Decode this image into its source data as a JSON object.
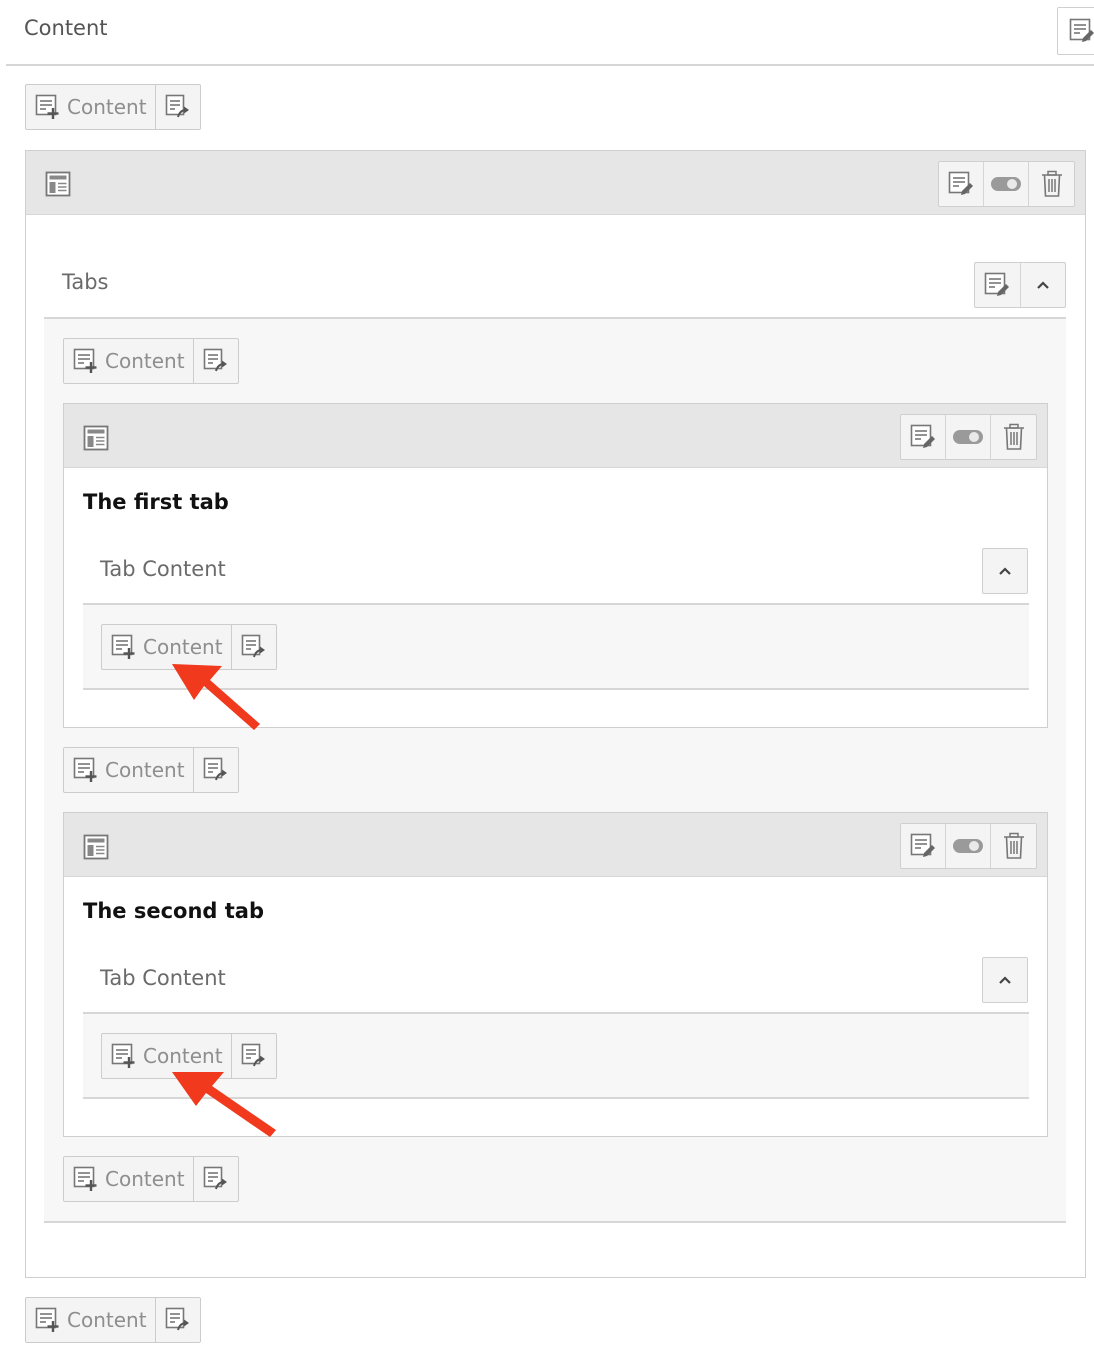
{
  "page": {
    "section_title": "Content",
    "new_content_label": "Content"
  },
  "tabs_container": {
    "title": "Tabs"
  },
  "tabs": [
    {
      "title": "The first tab",
      "column_label": "Tab Content"
    },
    {
      "title": "The second tab",
      "column_label": "Tab Content"
    }
  ],
  "colors": {
    "annotation_arrow": "#f0391d",
    "panel_header": "#e6e6e6",
    "button_bg": "#f4f4f4"
  },
  "icons": {
    "new_content": "doc-plus-icon",
    "paste": "doc-paste-icon",
    "edit": "doc-edit-icon",
    "toggle": "toggle-icon",
    "delete": "trash-icon",
    "element": "layout-icon",
    "collapse": "chevron-up-icon"
  }
}
